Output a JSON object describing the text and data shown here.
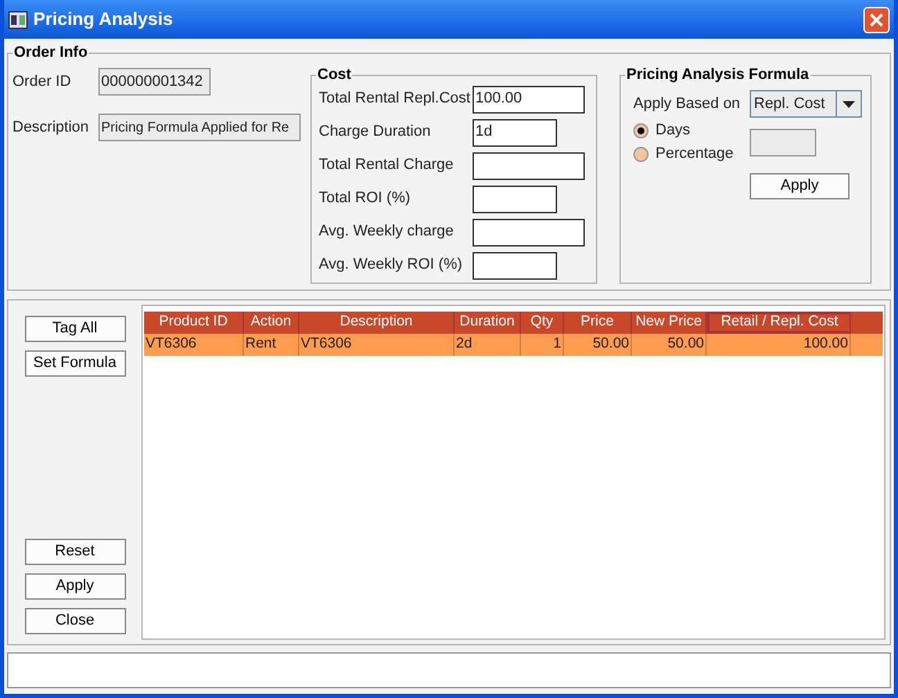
{
  "window": {
    "title": "Pricing Analysis"
  },
  "order_info": {
    "title": "Order Info",
    "fields": [
      {
        "label": "Order ID",
        "value": "000000001342"
      },
      {
        "label": "Description",
        "value": "Pricing Formula Applied for Re"
      }
    ]
  },
  "cost": {
    "title": "Cost",
    "fields": [
      {
        "label": "Total Rental Repl.Cost",
        "value": "100.00"
      },
      {
        "label": "Charge Duration",
        "value": "1d"
      },
      {
        "label": "Total Rental Charge"
      },
      {
        "label": "Total ROI (%)"
      },
      {
        "label": "Avg. Weekly charge"
      },
      {
        "label": "Avg. Weekly ROI (%)"
      }
    ]
  },
  "formula": {
    "title": "Pricing Analysis Formula",
    "apply_based_on_label": "Apply Based on",
    "apply_based_on": "Repl. Cost",
    "options": [
      {
        "label": "Days",
        "selected": true
      },
      {
        "label": "Percentage",
        "selected": false
      }
    ],
    "apply_button": "Apply"
  },
  "side_buttons_top": [
    "Tag All",
    "Set Formula"
  ],
  "side_buttons_bottom": [
    "Reset",
    "Apply",
    "Close"
  ],
  "table": {
    "columns": [
      "Product ID",
      "Action",
      "Description",
      "Duration",
      "Qty",
      "Price",
      "New Price",
      "Retail / Repl. Cost"
    ],
    "rows": [
      {
        "cells": [
          "VT6306",
          "Rent",
          "VT6306",
          "2d",
          "1",
          "50.00",
          "50.00",
          "100.00"
        ],
        "selected": true
      }
    ]
  }
}
